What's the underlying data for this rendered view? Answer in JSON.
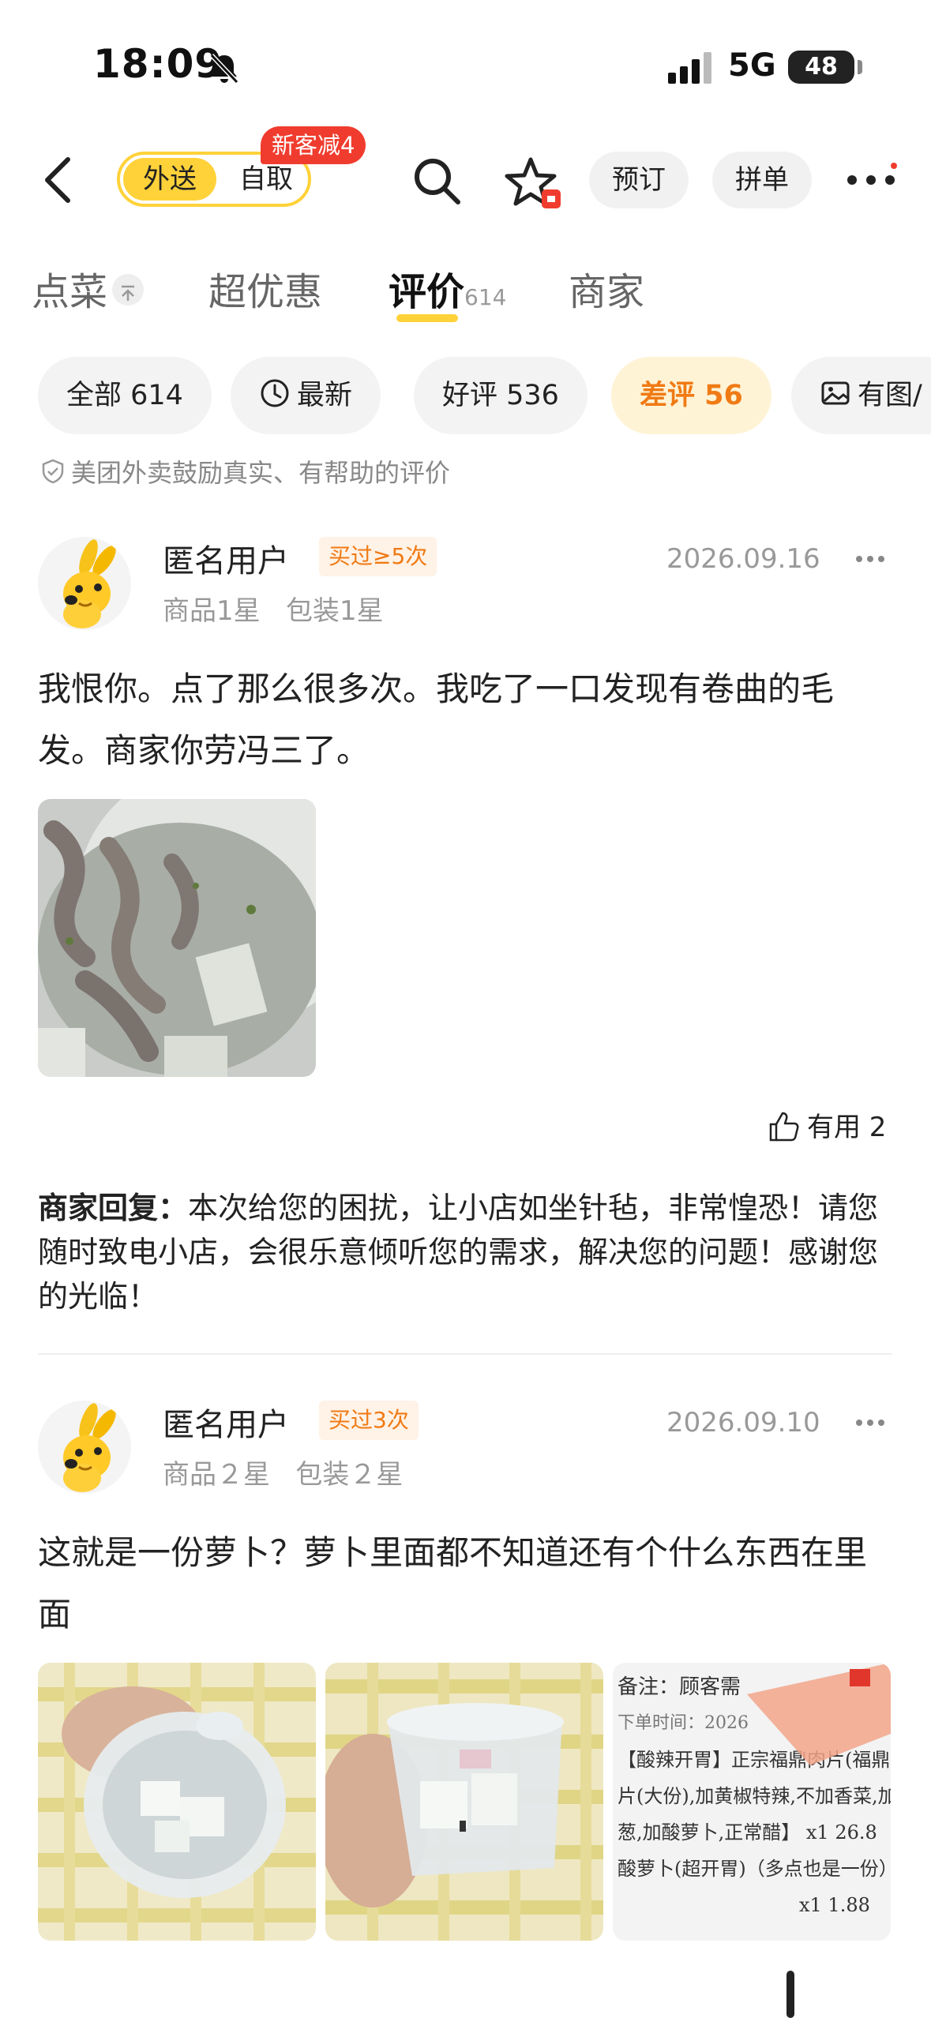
{
  "status_bar": {
    "time": "18:09",
    "network": "5G",
    "battery": "48"
  },
  "nav": {
    "mode_delivery": "外送",
    "mode_pickup": "自取",
    "promo_badge": "新客减4",
    "reserve_label": "预订",
    "group_order_label": "拼单"
  },
  "tabs": [
    {
      "label": "点菜"
    },
    {
      "label": "超优惠"
    },
    {
      "label": "评价",
      "count": "614"
    },
    {
      "label": "商家"
    }
  ],
  "filters": [
    {
      "label": "全部 614"
    },
    {
      "label": "最新"
    },
    {
      "label": "好评 536"
    },
    {
      "label": "差评 56"
    },
    {
      "label": "有图/"
    }
  ],
  "notice": "美团外卖鼓励真实、有帮助的评价",
  "reviews": [
    {
      "user": "匿名用户",
      "badge": "买过≥5次",
      "date": "2026.09.16",
      "ratings": "商品1星   包装1星",
      "text": "我恨你。点了那么很多次。我吃了一口发现有卷曲的毛发。商家你劳冯三了。",
      "useful": "有用 2",
      "reply_label": "商家回复：",
      "reply_text": "本次给您的困扰，让小店如坐针毡，非常惶恐！请您随时致电小店，会很乐意倾听您的需求，解决您的问题！感谢您的光临！"
    },
    {
      "user": "匿名用户",
      "badge": "买过3次",
      "date": "2026.09.10",
      "ratings": "商品２星   包装２星",
      "text": "这就是一份萝卜？萝卜里面都不知道还有个什么东西在里面"
    }
  ],
  "receipt": {
    "line1": "备注：顾客需",
    "line2": "下单时间：2026",
    "line3": "【酸辣开胃】正宗福鼎肉片(福鼎肉",
    "line4": "片(大份),加黄椒特辣,不加香菜,加",
    "line5": "葱,加酸萝卜,正常醋】  x1  26.8",
    "line6": "酸萝卜(超开胃)（多点也是一份）",
    "line7": "x1  1.88"
  },
  "colors": {
    "accent_yellow": "#ffd23a",
    "orange": "#f07a14",
    "red": "#f03c2e"
  }
}
